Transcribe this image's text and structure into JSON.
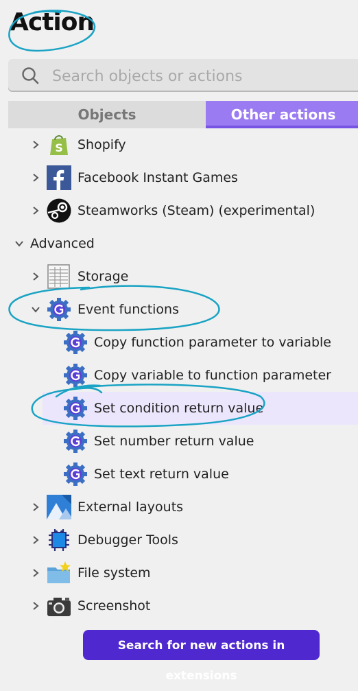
{
  "title": "Action",
  "search": {
    "placeholder": "Search objects or actions",
    "value": ""
  },
  "tabs": [
    {
      "label": "Objects",
      "active": false
    },
    {
      "label": "Other actions",
      "active": true
    }
  ],
  "tree": {
    "shopify": {
      "label": "Shopify",
      "icon": "shopify-icon",
      "expanded": false
    },
    "facebook": {
      "label": "Facebook Instant Games",
      "icon": "facebook-icon",
      "expanded": false
    },
    "steamworks": {
      "label": "Steamworks (Steam) (experimental)",
      "icon": "steam-icon",
      "expanded": false
    },
    "advanced": {
      "label": "Advanced",
      "expanded": true
    },
    "storage": {
      "label": "Storage",
      "icon": "storage-icon",
      "expanded": false
    },
    "event_functions": {
      "label": "Event functions",
      "icon": "gdevelop-gear-icon",
      "expanded": true,
      "items": [
        {
          "label": "Copy function parameter to variable",
          "selected": false
        },
        {
          "label": "Copy variable to function parameter",
          "selected": false
        },
        {
          "label": "Set condition return value",
          "selected": true
        },
        {
          "label": "Set number return value",
          "selected": false
        },
        {
          "label": "Set text return value",
          "selected": false
        }
      ]
    },
    "external_layouts": {
      "label": "External layouts",
      "icon": "external-layout-icon",
      "expanded": false
    },
    "debugger_tools": {
      "label": "Debugger Tools",
      "icon": "debugger-chip-icon",
      "expanded": false
    },
    "file_system": {
      "label": "File system",
      "icon": "folder-star-icon",
      "expanded": false
    },
    "screenshot": {
      "label": "Screenshot",
      "icon": "camera-icon",
      "expanded": false
    }
  },
  "cta_label": "Search for new actions in extensions",
  "colors": {
    "accent": "#9b7bf2",
    "cta": "#4f28cf",
    "selected_row": "#ece6fc",
    "annotation": "#1aa3c4"
  }
}
